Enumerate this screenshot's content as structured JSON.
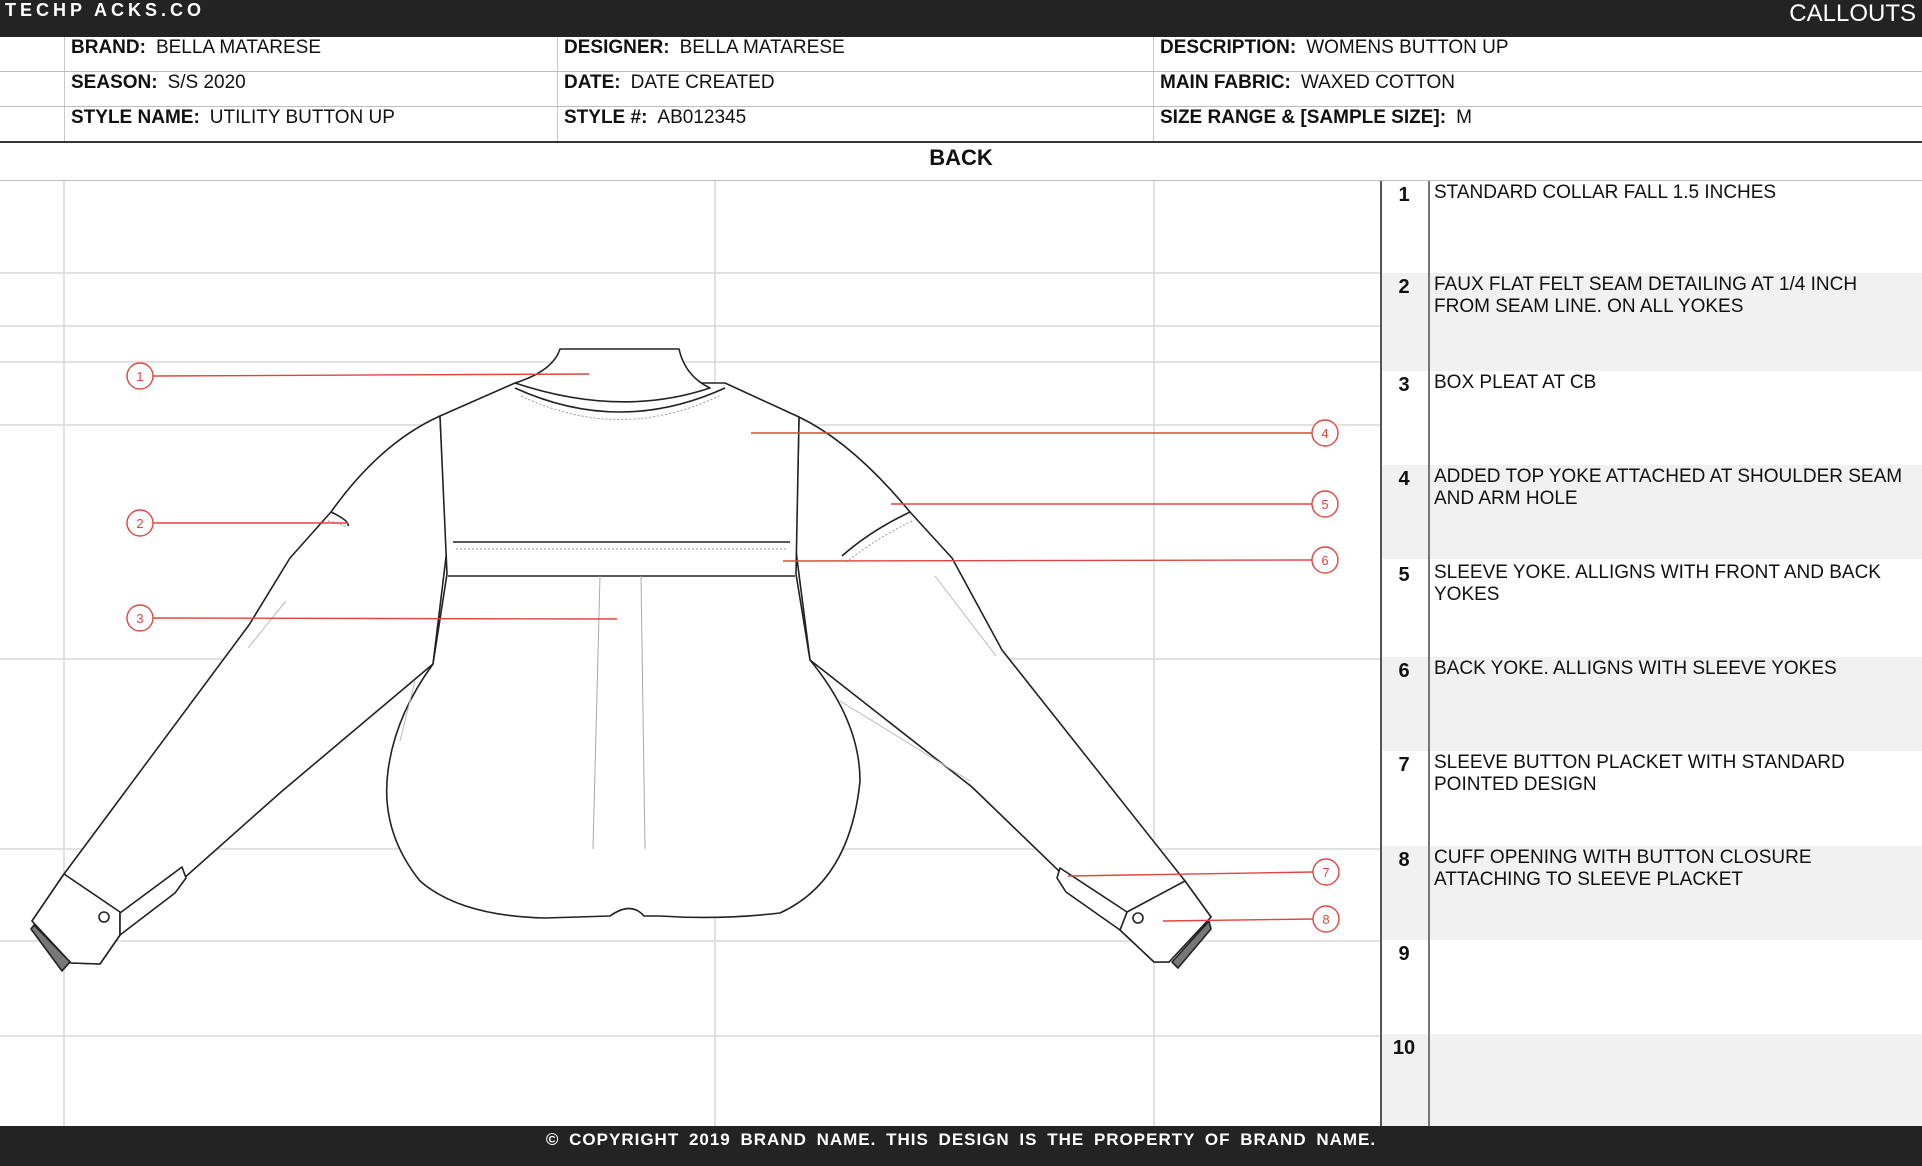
{
  "header": {
    "logo": "TECHP ACKS.CO",
    "section_title": "CALLOUTS"
  },
  "info": {
    "brand": {
      "label": "BRAND:",
      "value": "BELLA MATARESE"
    },
    "designer": {
      "label": "DESIGNER:",
      "value": "BELLA MATARESE"
    },
    "description": {
      "label": "DESCRIPTION:",
      "value": "WOMENS BUTTON UP"
    },
    "season": {
      "label": "SEASON:",
      "value": "S/S 2020"
    },
    "date": {
      "label": "DATE:",
      "value": "DATE CREATED"
    },
    "main_fabric": {
      "label": "MAIN FABRIC:",
      "value": "WAXED COTTON"
    },
    "style_name": {
      "label": "STYLE NAME:",
      "value": "UTILITY BUTTON UP"
    },
    "style_no": {
      "label": "STYLE #:",
      "value": "AB012345"
    },
    "size_range": {
      "label": "SIZE RANGE & [SAMPLE SIZE]:",
      "value": "M"
    }
  },
  "view_title": "BACK",
  "drawing": {
    "markers": [
      "1",
      "2",
      "3",
      "4",
      "5",
      "6",
      "7",
      "8"
    ],
    "line_color": "#e0463f"
  },
  "callouts": [
    {
      "num": "1",
      "text": "STANDARD COLLAR FALL 1.5 INCHES"
    },
    {
      "num": "2",
      "text": "FAUX FLAT FELT SEAM DETAILING AT 1/4 INCH FROM SEAM LINE. ON ALL YOKES"
    },
    {
      "num": "3",
      "text": "BOX PLEAT AT CB"
    },
    {
      "num": "4",
      "text": "ADDED TOP YOKE ATTACHED AT SHOULDER SEAM AND ARM HOLE"
    },
    {
      "num": "5",
      "text": "SLEEVE YOKE. ALLIGNS WITH FRONT AND BACK YOKES"
    },
    {
      "num": "6",
      "text": "BACK YOKE. ALLIGNS WITH SLEEVE YOKES"
    },
    {
      "num": "7",
      "text": "SLEEVE BUTTON PLACKET WITH STANDARD POINTED DESIGN"
    },
    {
      "num": "8",
      "text": "CUFF OPENING WITH BUTTON CLOSURE ATTACHING TO SLEEVE PLACKET"
    },
    {
      "num": "9",
      "text": ""
    },
    {
      "num": "10",
      "text": ""
    }
  ],
  "footer": "© COPYRIGHT 2019 BRAND NAME.  THIS DESIGN IS THE PROPERTY OF BRAND NAME."
}
